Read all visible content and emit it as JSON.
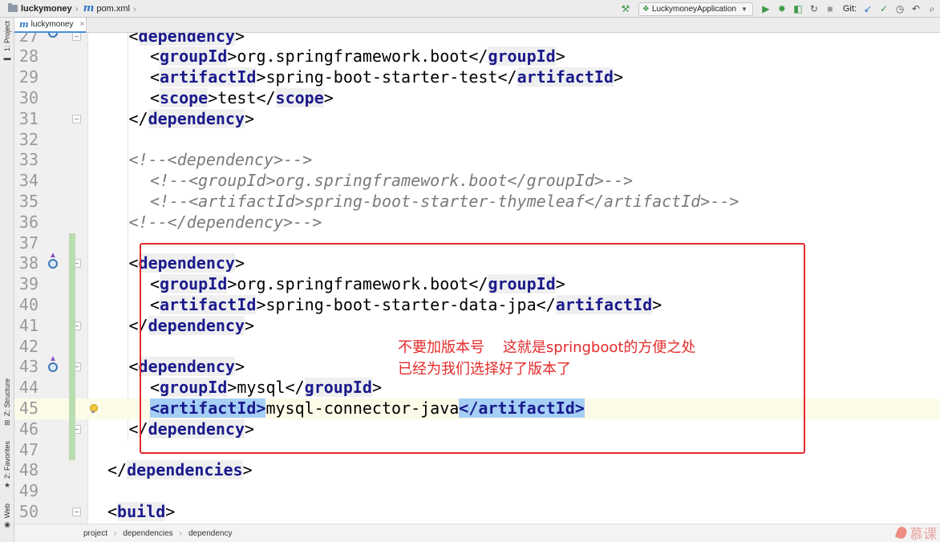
{
  "navbar": {
    "project": "luckymoney",
    "file": "pom.xml",
    "run_config": "LuckymoneyApplication",
    "git_label": "Git:"
  },
  "tab": {
    "label": "luckymoney"
  },
  "left_strip": {
    "project_tab": "1: Project",
    "structure_tab": "Z: Structure",
    "favorites_tab": "2: Favorites",
    "web_tab": "Web"
  },
  "editor": {
    "current_line": "45",
    "lines": [
      {
        "num": "27",
        "indent": 2,
        "parts": [
          [
            "b",
            "<"
          ],
          [
            "t",
            "dependency"
          ],
          [
            "b",
            ">"
          ]
        ]
      },
      {
        "num": "28",
        "indent": 4,
        "parts": [
          [
            "b",
            "<"
          ],
          [
            "t",
            "groupId"
          ],
          [
            "b",
            ">"
          ],
          [
            "x",
            "org.springframework.boot"
          ],
          [
            "b",
            "</"
          ],
          [
            "t",
            "groupId"
          ],
          [
            "b",
            ">"
          ]
        ]
      },
      {
        "num": "29",
        "indent": 4,
        "parts": [
          [
            "b",
            "<"
          ],
          [
            "t",
            "artifactId"
          ],
          [
            "b",
            ">"
          ],
          [
            "x",
            "spring-boot-starter-test"
          ],
          [
            "b",
            "</"
          ],
          [
            "t",
            "artifactId"
          ],
          [
            "b",
            ">"
          ]
        ]
      },
      {
        "num": "30",
        "indent": 4,
        "parts": [
          [
            "b",
            "<"
          ],
          [
            "t",
            "scope"
          ],
          [
            "b",
            ">"
          ],
          [
            "x",
            "test"
          ],
          [
            "b",
            "</"
          ],
          [
            "t",
            "scope"
          ],
          [
            "b",
            ">"
          ]
        ]
      },
      {
        "num": "31",
        "indent": 2,
        "parts": [
          [
            "b",
            "</"
          ],
          [
            "t",
            "dependency"
          ],
          [
            "b",
            ">"
          ]
        ]
      },
      {
        "num": "32",
        "indent": 0,
        "parts": []
      },
      {
        "num": "33",
        "indent": 2,
        "parts": [
          [
            "c",
            "<!--<dependency>-->"
          ]
        ]
      },
      {
        "num": "34",
        "indent": 4,
        "parts": [
          [
            "c",
            "<!--<groupId>org.springframework.boot</groupId>-->"
          ]
        ]
      },
      {
        "num": "35",
        "indent": 4,
        "parts": [
          [
            "c",
            "<!--<artifactId>spring-boot-starter-thymeleaf</artifactId>-->"
          ]
        ]
      },
      {
        "num": "36",
        "indent": 2,
        "parts": [
          [
            "c",
            "<!--</dependency>-->"
          ]
        ]
      },
      {
        "num": "37",
        "indent": 0,
        "parts": []
      },
      {
        "num": "38",
        "indent": 2,
        "parts": [
          [
            "b",
            "<"
          ],
          [
            "t",
            "dependency"
          ],
          [
            "b",
            ">"
          ]
        ]
      },
      {
        "num": "39",
        "indent": 4,
        "parts": [
          [
            "b",
            "<"
          ],
          [
            "t",
            "groupId"
          ],
          [
            "b",
            ">"
          ],
          [
            "x",
            "org.springframework.boot"
          ],
          [
            "b",
            "</"
          ],
          [
            "t",
            "groupId"
          ],
          [
            "b",
            ">"
          ]
        ]
      },
      {
        "num": "40",
        "indent": 4,
        "parts": [
          [
            "b",
            "<"
          ],
          [
            "t",
            "artifactId"
          ],
          [
            "b",
            ">"
          ],
          [
            "x",
            "spring-boot-starter-data-jpa"
          ],
          [
            "b",
            "</"
          ],
          [
            "t",
            "artifactId"
          ],
          [
            "b",
            ">"
          ]
        ]
      },
      {
        "num": "41",
        "indent": 2,
        "parts": [
          [
            "b",
            "</"
          ],
          [
            "t",
            "dependency"
          ],
          [
            "b",
            ">"
          ]
        ]
      },
      {
        "num": "42",
        "indent": 0,
        "parts": []
      },
      {
        "num": "43",
        "indent": 2,
        "parts": [
          [
            "b",
            "<"
          ],
          [
            "t",
            "dependency"
          ],
          [
            "b",
            ">"
          ]
        ]
      },
      {
        "num": "44",
        "indent": 4,
        "parts": [
          [
            "b",
            "<"
          ],
          [
            "t",
            "groupId"
          ],
          [
            "b",
            ">"
          ],
          [
            "x",
            "mysql"
          ],
          [
            "b",
            "</"
          ],
          [
            "t",
            "groupId"
          ],
          [
            "b",
            ">"
          ]
        ]
      },
      {
        "num": "45",
        "indent": 4,
        "parts": [
          [
            "h",
            "<artifactId>"
          ],
          [
            "x",
            "mysql-connector-java"
          ],
          [
            "h",
            "</artifactId>"
          ]
        ]
      },
      {
        "num": "46",
        "indent": 2,
        "parts": [
          [
            "b",
            "</"
          ],
          [
            "t",
            "dependency"
          ],
          [
            "b",
            ">"
          ]
        ]
      },
      {
        "num": "47",
        "indent": 0,
        "parts": []
      },
      {
        "num": "48",
        "indent": 0,
        "parts": [
          [
            "b",
            "</"
          ],
          [
            "t",
            "dependencies"
          ],
          [
            "b",
            ">"
          ]
        ]
      },
      {
        "num": "49",
        "indent": 0,
        "parts": []
      },
      {
        "num": "50",
        "indent": 0,
        "parts": [
          [
            "b",
            "<"
          ],
          [
            "t",
            "build"
          ],
          [
            "b",
            ">"
          ]
        ]
      }
    ]
  },
  "annotation": {
    "line1": "不要加版本号    这就是springboot的方便之处",
    "line2": "已经为我们选择好了版本了",
    "color": "#e32b2b"
  },
  "breadcrumb": [
    "project",
    "dependencies",
    "dependency"
  ],
  "watermark": "慕课",
  "colors": {
    "tag": "#1a1a8c",
    "comment": "#7a7a7a",
    "selection": "#a6cff5",
    "current_line": "#fcfbe8"
  }
}
